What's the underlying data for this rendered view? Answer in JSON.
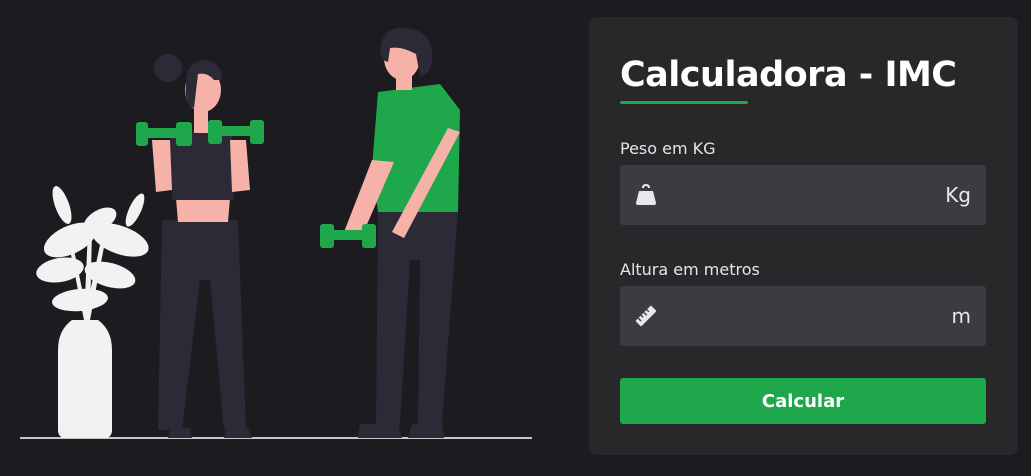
{
  "colors": {
    "background": "#1c1b1f",
    "panel": "#28282b",
    "field": "#3b3b41",
    "accent": "#1ea84b",
    "text": "#ffffff"
  },
  "illustration": {
    "subject": "two people exercising with green dumbbells next to a potted plant"
  },
  "form": {
    "title": "Calculadora - IMC",
    "weight": {
      "label": "Peso em KG",
      "value": "",
      "placeholder": "",
      "unit": "Kg",
      "icon": "weight-icon"
    },
    "height": {
      "label": "Altura em metros",
      "value": "",
      "placeholder": "",
      "unit": "m",
      "icon": "ruler-icon"
    },
    "submit_label": "Calcular"
  }
}
